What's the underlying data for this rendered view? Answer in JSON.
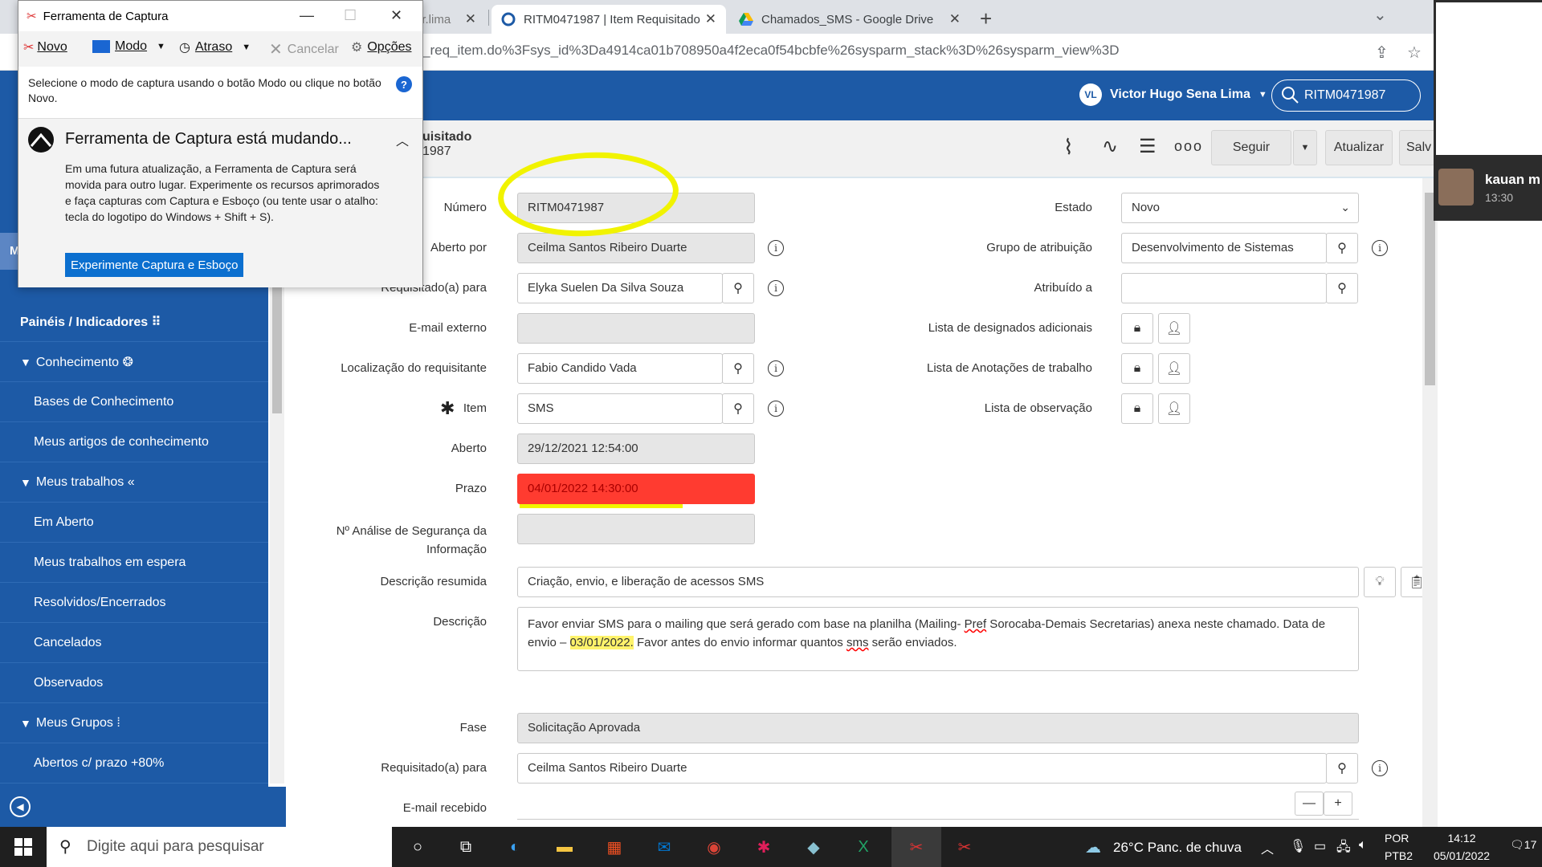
{
  "browser": {
    "tabs": [
      {
        "title": "or.lima",
        "close": "✕"
      },
      {
        "title": "RITM0471987 | Item Requisitado",
        "close": "✕"
      },
      {
        "title": "Chamados_SMS - Google Drive",
        "close": "✕"
      }
    ],
    "url": "_req_item.do%3Fsys_id%3Da4914ca01b708950a4f2eca0f54bcbfe%26sysparm_stack%3D%26sysparm_view%3D"
  },
  "header": {
    "user_initials": "VL",
    "user_name": "Victor Hugo Sena Lima",
    "search_value": "RITM0471987"
  },
  "nav": {
    "items": [
      {
        "label": "Painéis / Indicadores ⠿",
        "type": "top"
      },
      {
        "label": "Conhecimento ❂",
        "type": "head"
      },
      {
        "label": "Bases de Conhecimento",
        "type": "sub"
      },
      {
        "label": "Meus artigos de conhecimento",
        "type": "sub"
      },
      {
        "label": "Meus trabalhos «",
        "type": "head"
      },
      {
        "label": "Em Aberto",
        "type": "sub"
      },
      {
        "label": "Meus trabalhos em espera",
        "type": "sub"
      },
      {
        "label": "Resolvidos/Encerrados",
        "type": "sub"
      },
      {
        "label": "Cancelados",
        "type": "sub"
      },
      {
        "label": "Observados",
        "type": "sub"
      },
      {
        "label": "Meus Grupos ⁞",
        "type": "head"
      },
      {
        "label": "Abertos c/ prazo +80%",
        "type": "sub"
      }
    ],
    "partial_label": "M"
  },
  "record": {
    "title": "uisitado",
    "number_partial": "1987",
    "buttons": {
      "follow": "Seguir",
      "update": "Atualizar",
      "save": "Salv"
    }
  },
  "form": {
    "left": [
      {
        "label": "Número",
        "value": "RITM0471987"
      },
      {
        "label": "Aberto por",
        "value": "Ceilma Santos Ribeiro Duarte"
      },
      {
        "label": "Requisitado(a) para",
        "value": "Elyka Suelen Da Silva Souza"
      },
      {
        "label": "E-mail externo",
        "value": ""
      },
      {
        "label": "Localização do requisitante",
        "value": "Fabio Candido Vada"
      },
      {
        "label": "Item",
        "value": "SMS"
      },
      {
        "label": "Aberto",
        "value": "29/12/2021 12:54:00"
      },
      {
        "label": "Prazo",
        "value": "04/01/2022 14:30:00"
      },
      {
        "label": "Nº Análise de Segurança da",
        "label2": "Informação",
        "value": ""
      }
    ],
    "right": [
      {
        "label": "Estado",
        "value": "Novo"
      },
      {
        "label": "Grupo de atribuição",
        "value": "Desenvolvimento de Sistemas"
      },
      {
        "label": "Atribuído a",
        "value": ""
      },
      {
        "label": "Lista de designados adicionais"
      },
      {
        "label": "Lista de Anotações de trabalho"
      },
      {
        "label": "Lista de observação"
      }
    ],
    "short_desc": {
      "label": "Descrição resumida",
      "value": "Criação, envio, e liberação de acessos  SMS"
    },
    "description": {
      "label": "Descrição",
      "part1": "Favor enviar SMS para o mailing que será gerado com base na planilha (Mailing- ",
      "part_pref": "Pref",
      "part2": " Sorocaba-Demais Secretarias) anexa neste chamado. Data de envio – ",
      "part_date": "03/01/2022.",
      "part3": " Favor antes do envio informar quantos ",
      "part_sms": "sms",
      "part4": " serão enviados."
    },
    "fase": {
      "label": "Fase",
      "value": "Solicitação Aprovada"
    },
    "req_for2": {
      "label": "Requisitado(a) para",
      "value": "Ceilma Santos Ribeiro Duarte"
    },
    "email_received": {
      "label": "E-mail recebido"
    }
  },
  "snip": {
    "title": "Ferramenta de Captura",
    "buttons": {
      "new": "Novo",
      "mode": "Modo",
      "delay": "Atraso",
      "cancel": "Cancelar",
      "options": "Opções"
    },
    "hint": "Selecione o modo de captura usando o botão Modo ou clique no botão Novo.",
    "panel_title": "Ferramenta de Captura está mudando...",
    "panel_body": "Em uma futura atualização, a Ferramenta de Captura será movida para outro lugar. Experimente os recursos aprimorados e faça capturas com Captura e Esboço (ou tente usar o atalho: tecla do logotipo do Windows + Shift + S).",
    "cta": "Experimente Captura e Esboço"
  },
  "thumbnail": {
    "name": "kauan m",
    "time": "13:30"
  },
  "taskbar": {
    "search_placeholder": "Digite aqui para pesquisar",
    "weather": "26°C  Panc. de chuva",
    "lang1": "POR",
    "lang2": "PTB2",
    "time": "14:12",
    "date": "05/01/2022",
    "notif": "17"
  },
  "colors": {
    "brand": "#1d5aa6",
    "overdue": "#ff3b30",
    "highlight": "#f1f300"
  }
}
